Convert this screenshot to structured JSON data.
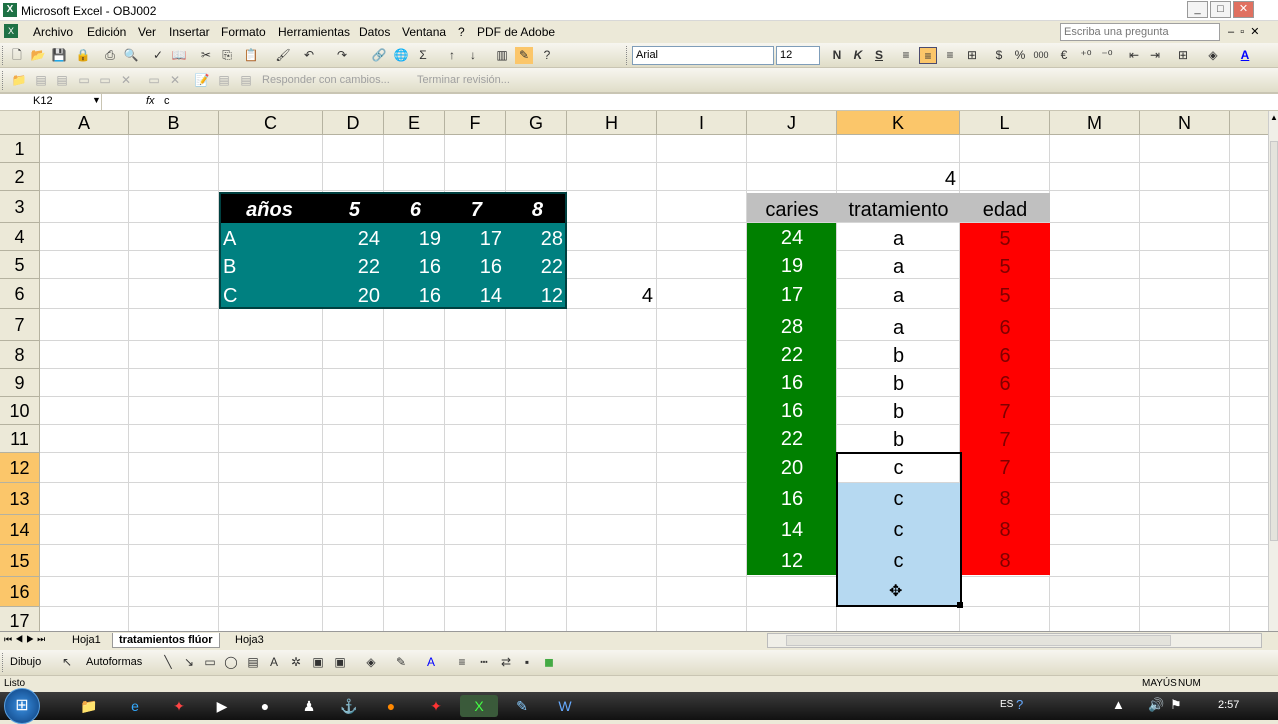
{
  "window": {
    "title": "Microsoft Excel - OBJ002"
  },
  "menu": [
    "Archivo",
    "Edición",
    "Ver",
    "Insertar",
    "Formato",
    "Herramientas",
    "Datos",
    "Ventana",
    "?",
    "PDF de Adobe"
  ],
  "help_placeholder": "Escriba una pregunta",
  "font": {
    "name": "Arial",
    "size": "12"
  },
  "review_toolbar": {
    "reply": "Responder con cambios...",
    "end": "Terminar revisión..."
  },
  "formula_bar": {
    "name_box": "K12",
    "fx": "fx",
    "content": "c"
  },
  "columns": [
    "A",
    "B",
    "C",
    "D",
    "E",
    "F",
    "G",
    "H",
    "I",
    "J",
    "K",
    "L",
    "M",
    "N"
  ],
  "rows": [
    "1",
    "2",
    "3",
    "4",
    "5",
    "6",
    "7",
    "8",
    "9",
    "10",
    "11",
    "12",
    "13",
    "14",
    "15",
    "16",
    "17"
  ],
  "table1": {
    "header": [
      "años",
      "5",
      "6",
      "7",
      "8"
    ],
    "rows": [
      [
        "A",
        "24",
        "19",
        "17",
        "28"
      ],
      [
        "B",
        "22",
        "16",
        "16",
        "22"
      ],
      [
        "C",
        "20",
        "16",
        "14",
        "12"
      ]
    ],
    "h6": "4"
  },
  "table2": {
    "k2": "4",
    "headers": [
      "caries",
      "tratamiento",
      "edad"
    ],
    "caries": [
      "24",
      "19",
      "17",
      "28",
      "22",
      "16",
      "16",
      "22",
      "20",
      "16",
      "14",
      "12"
    ],
    "tratamiento": [
      "a",
      "a",
      "a",
      "a",
      "b",
      "b",
      "b",
      "b",
      "c",
      "c",
      "c",
      "c"
    ],
    "edad": [
      "5",
      "5",
      "5",
      "6",
      "6",
      "6",
      "7",
      "7",
      "7",
      "8",
      "8",
      "8"
    ]
  },
  "sheets": [
    "Hoja1",
    "tratamientos flúor",
    "Hoja3"
  ],
  "draw": {
    "dibujo": "Dibujo",
    "autoformas": "Autoformas"
  },
  "status": {
    "left": "Listo",
    "caps": "MAYÚS",
    "num": "NUM"
  },
  "taskbar": {
    "lang": "ES",
    "time": "2:57"
  }
}
